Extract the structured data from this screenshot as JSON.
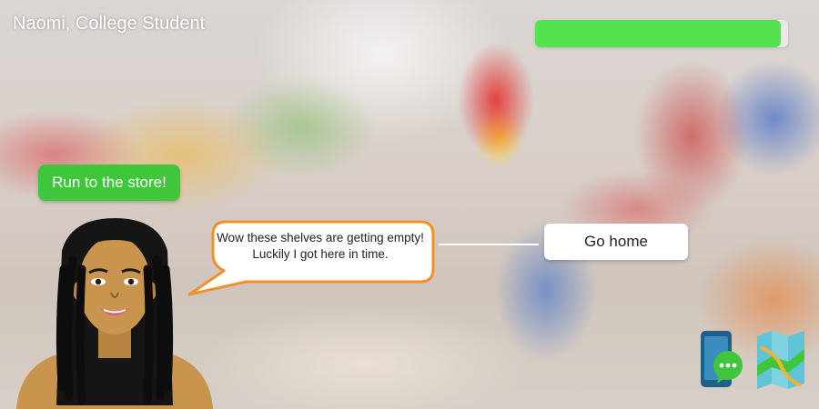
{
  "header": {
    "title": "Naomi, College Student"
  },
  "status": {
    "health_fraction": 0.97,
    "health_color": "#52e34f"
  },
  "actions": {
    "primary_label": "Run to the store!"
  },
  "dialogue": {
    "speech": "Wow these shelves are getting empty! Luckily I got here in time."
  },
  "choices": [
    {
      "label": "Go home"
    }
  ],
  "toolbar": {
    "icons": [
      "phone-chat-icon",
      "map-icon"
    ]
  }
}
